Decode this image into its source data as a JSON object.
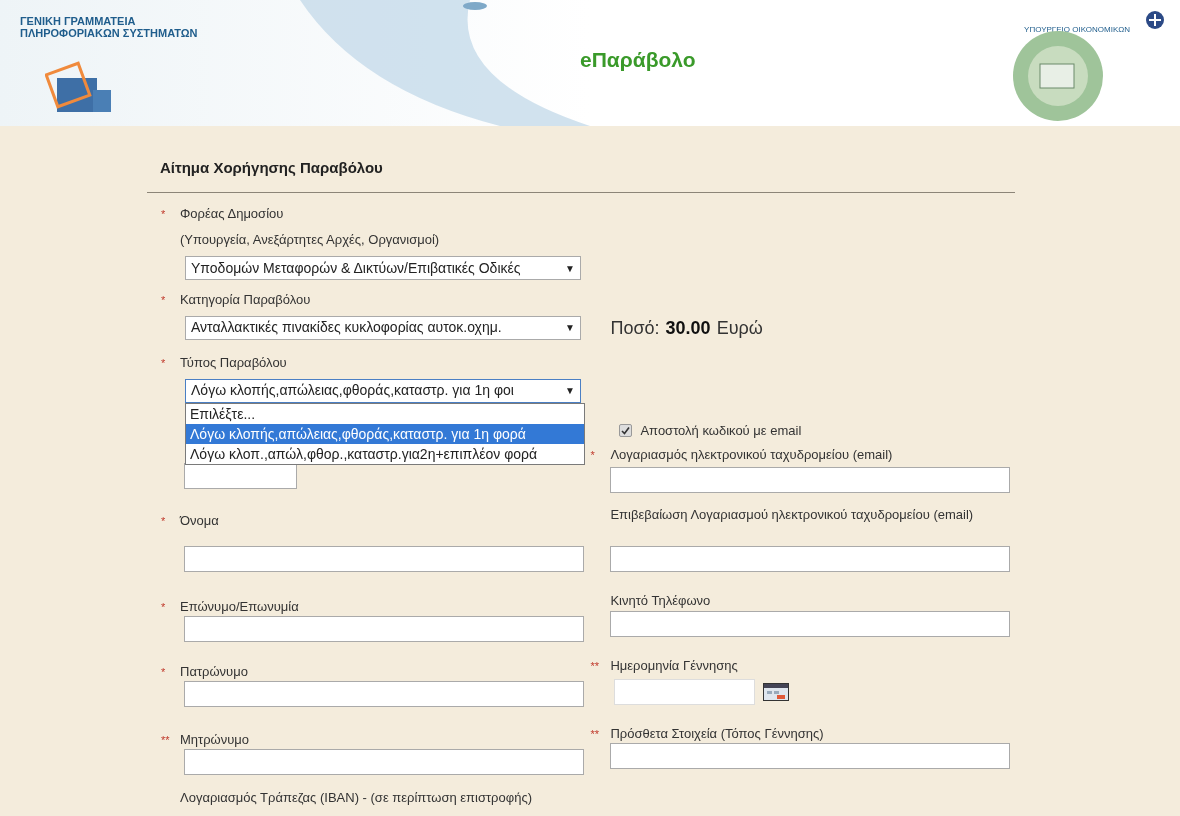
{
  "header": {
    "org_lines": [
      "ΓΕΝΙΚΗ ΓΡΑΜΜΑΤΕΙΑ",
      "ΠΛΗΡΟΦΟΡΙΑΚΩΝ ΣΥΣΤΗΜΑΤΩΝ"
    ],
    "title": "eΠαράβολο",
    "ministry": "ΥΠΟΥΡΓΕΙΟ ΟΙΚΟΝΟΜΙΚΩΝ"
  },
  "form": {
    "title": "Αίτημα Χορήγησης Παραβόλου",
    "rows": [
      {
        "left": {
          "kind": "select",
          "marker": "*",
          "label": "Φορέας Δημοσίου",
          "sublabel": "(Υπουργεία, Ανεξάρτητες Αρχές, Οργανισμοί)",
          "value": "Υποδομών Μεταφορών & Δικτύων/Επιβατικές Οδικές",
          "arrow": "▼"
        }
      },
      {
        "left": {
          "kind": "select",
          "marker": "*",
          "label": "Κατηγορία Παραβόλου",
          "value": "Ανταλλακτικές πινακίδες κυκλοφορίας αυτοκ.οχημ.",
          "arrow": "▼"
        },
        "right": {
          "kind": "amount",
          "label": "Ποσό:",
          "value": "30.00",
          "unit": "Ευρώ"
        }
      },
      {
        "left": {
          "kind": "select",
          "marker": "*",
          "label": "Τύπος Παραβόλου",
          "value": "Λόγω κλοπής,απώλειας,φθοράς,καταστρ. για 1η φοι",
          "arrow": "▼",
          "expanded": true,
          "options": [
            {
              "label": "Επιλέξτε...",
              "selected": false
            },
            {
              "label": "Λόγω κλοπής,απώλειας,φθοράς,καταστρ. για 1η φορά",
              "selected": true
            },
            {
              "label": "Λόγω κλοπ.,απώλ,φθορ.,καταστρ.για2η+επιπλέον φορά",
              "selected": false
            }
          ]
        }
      },
      {
        "left": {
          "kind": "short_text"
        },
        "right": {
          "kind": "email",
          "checkbox": {
            "label": "Αποστολή κωδικού με email",
            "checked": true
          },
          "marker": "*",
          "label": "Λογαριασμός ηλεκτρονικού ταχυδρομείου (email)"
        }
      },
      {
        "left": {
          "kind": "text",
          "marker": "*",
          "label": "Όνομα"
        },
        "right": {
          "kind": "text",
          "label": "Επιβεβαίωση Λογαριασμού ηλεκτρονικού ταχυδρομείου (email)"
        }
      },
      {
        "left": {
          "kind": "text",
          "marker": "*",
          "label": "Επώνυμο/Επωνυμία"
        },
        "right": {
          "kind": "text",
          "label": "Κινητό Τηλέφωνο"
        }
      },
      {
        "left": {
          "kind": "text",
          "marker": "*",
          "label": "Πατρώνυμο"
        },
        "right": {
          "kind": "date",
          "marker": "**",
          "label": "Ημερομηνία Γέννησης"
        }
      },
      {
        "left": {
          "kind": "text",
          "marker": "**",
          "label": "Μητρώνυμο"
        },
        "right": {
          "kind": "text",
          "marker": "**",
          "label": "Πρόσθετα Στοιχεία (Τόπος Γέννησης)"
        }
      },
      {
        "left": {
          "kind": "label_only",
          "label": "Λογαριασμός Τράπεζας (IBAN) - (σε περίπτωση επιστροφής)"
        }
      }
    ]
  }
}
